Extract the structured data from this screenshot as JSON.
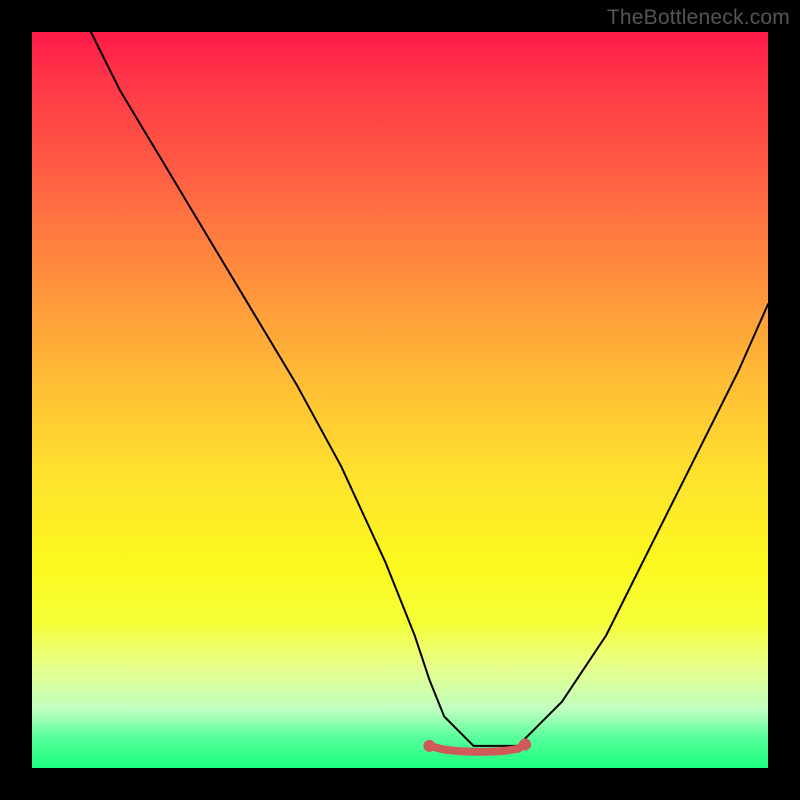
{
  "watermark": {
    "text": "TheBottleneck.com"
  },
  "chart_data": {
    "type": "line",
    "title": "",
    "xlabel": "",
    "ylabel": "",
    "xlim": [
      0,
      100
    ],
    "ylim": [
      0,
      100
    ],
    "series": [
      {
        "name": "curve",
        "x": [
          8,
          12,
          18,
          24,
          30,
          36,
          42,
          48,
          52,
          54,
          56,
          60,
          64,
          66,
          68,
          72,
          78,
          84,
          90,
          96,
          100
        ],
        "values": [
          100,
          92,
          82,
          72,
          62,
          52,
          41,
          28,
          18,
          12,
          7,
          3,
          3,
          3,
          5,
          9,
          18,
          30,
          42,
          54,
          63
        ]
      },
      {
        "name": "highlight-flat-bottom",
        "x": [
          54,
          56,
          58,
          60,
          62,
          64,
          66,
          67
        ],
        "values": [
          3,
          2.5,
          2.3,
          2.2,
          2.2,
          2.3,
          2.6,
          3.2
        ]
      }
    ],
    "colors": {
      "curve": "#000000",
      "highlight": "#d05a5a",
      "gradient_top": "#ff1a4a",
      "gradient_bottom": "#1aff80"
    }
  }
}
